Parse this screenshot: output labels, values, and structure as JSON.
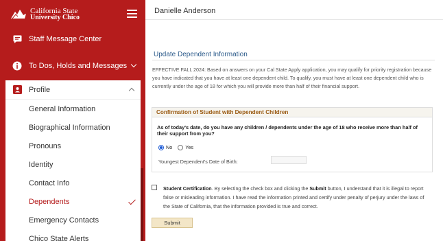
{
  "brand": {
    "line1": "California State",
    "line2": "University Chico"
  },
  "sidebar": {
    "items": [
      {
        "label": "Staff Message Center",
        "icon": "message-icon"
      },
      {
        "label": "To Dos, Holds and Messages",
        "icon": "info-icon"
      }
    ],
    "profile": {
      "label": "Profile",
      "icon": "profile-card-icon",
      "sub_items": [
        {
          "label": "General Information"
        },
        {
          "label": "Biographical Information"
        },
        {
          "label": "Pronouns"
        },
        {
          "label": "Identity"
        },
        {
          "label": "Contact Info"
        },
        {
          "label": "Dependents",
          "active": true
        },
        {
          "label": "Emergency Contacts"
        },
        {
          "label": "Chico State Alerts"
        }
      ]
    }
  },
  "main": {
    "user_name": "Danielle Anderson",
    "title": "Update Dependent Information",
    "intro": "EFFECTIVE FALL 2024: Based on answers on your Cal State Apply application, you may qualify for priority registration because you have indicated that you have at least one dependent child. To qualify, you must have at least one dependent child who is currently under the age of 18 for which you will provide more than half of their financial support.",
    "confirm": {
      "heading": "Confirmation of Student with Dependent Children",
      "question": "As of today's date, do you have any children / dependents under the age of 18 who receive more than half of their support from you?",
      "option_no": "No",
      "option_yes": "Yes",
      "selected": "No",
      "dob_label": "Youngest Dependent's Date of Birth:",
      "dob_value": ""
    },
    "certification": {
      "lead": "Student Certification",
      "text_a": ". By selecting the check box and clicking the ",
      "submit_word": "Submit",
      "text_b": " button, I understand that it is illegal to report false or misleading information. I have read the information printed and certify under penalty of perjury under the laws of the State of California, that the information provided is true and correct."
    },
    "submit_label": "Submit"
  },
  "colors": {
    "brand_red": "#b51c1c",
    "title_blue": "#2b5a8a",
    "section_brown": "#9a5a12",
    "button_tan": "#f3e6c7"
  }
}
